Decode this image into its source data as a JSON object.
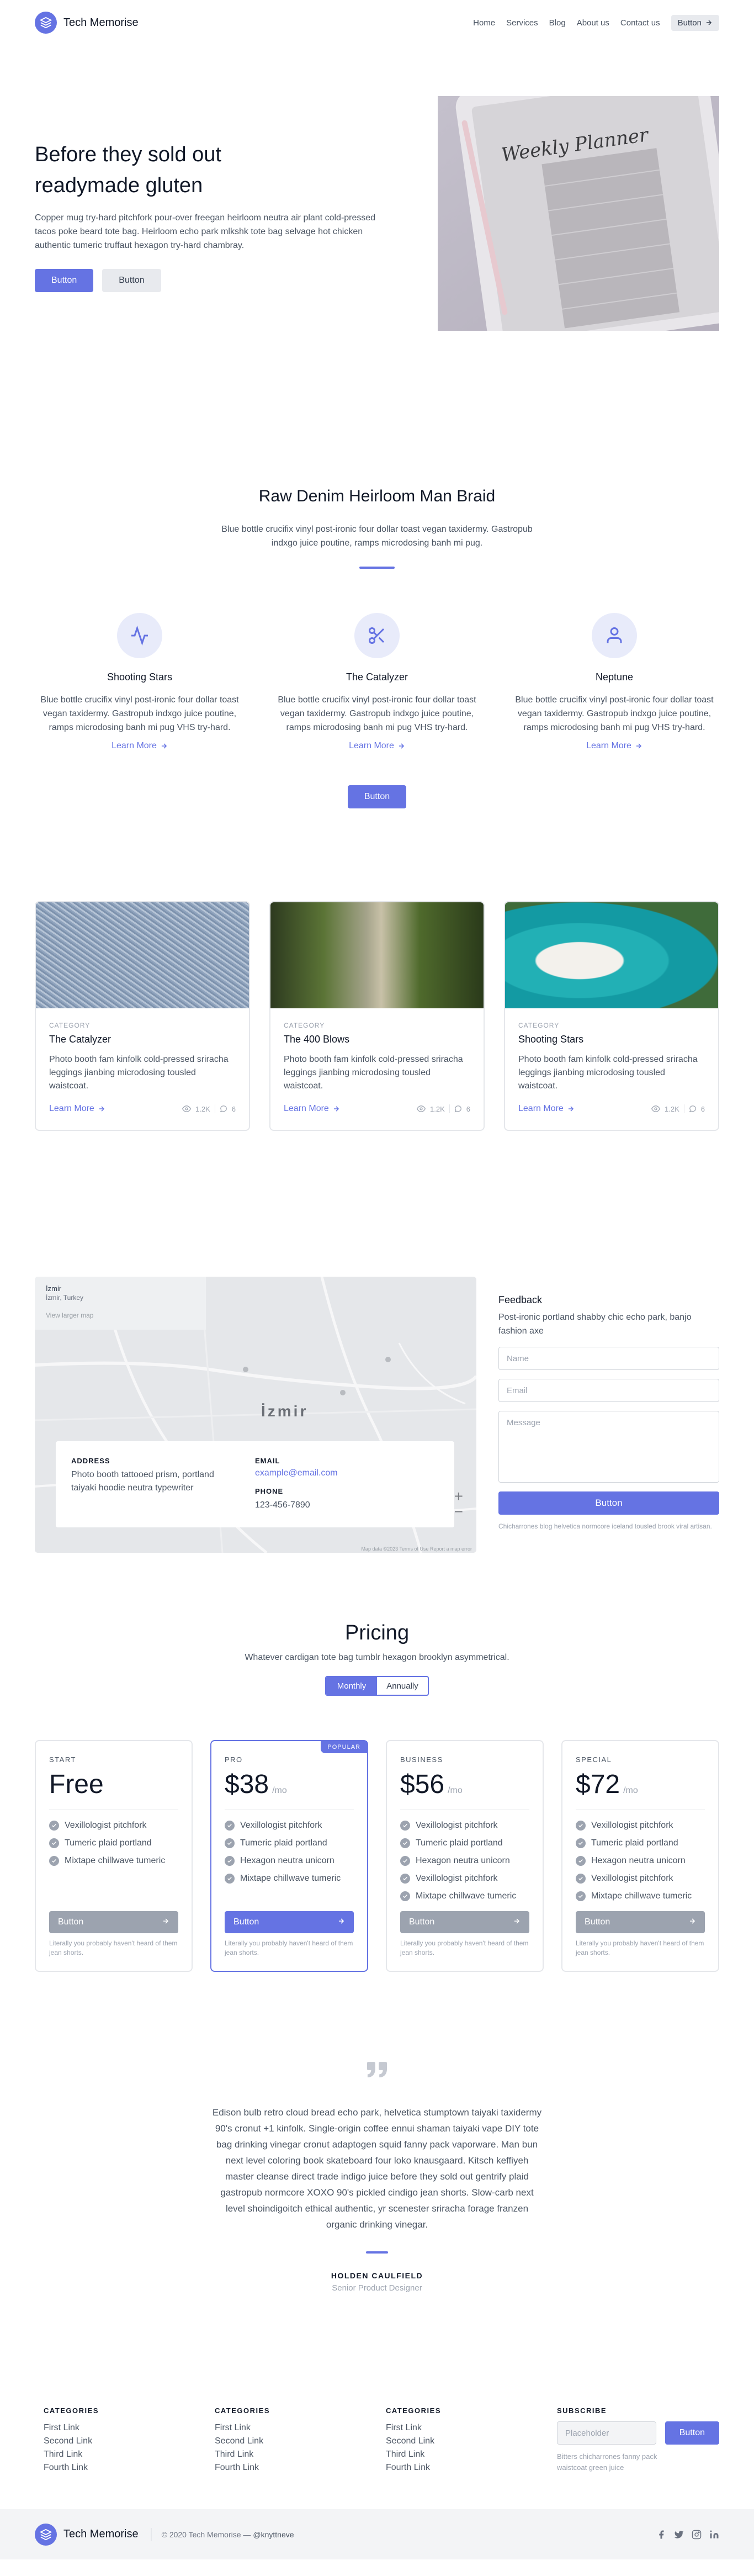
{
  "brand": {
    "name": "Tech Memorise"
  },
  "nav": {
    "items": [
      "Home",
      "Services",
      "Blog",
      "About us",
      "Contact us"
    ],
    "button": "Button"
  },
  "hero": {
    "title": "Before they sold out readymade gluten",
    "text": "Copper mug try-hard pitchfork pour-over freegan heirloom neutra air plant cold-pressed tacos poke beard tote bag. Heirloom echo park mlkshk tote bag selvage hot chicken authentic tumeric truffaut hexagon try-hard chambray.",
    "primary_button": "Button",
    "secondary_button": "Button",
    "image_text": "Weekly Planner"
  },
  "features": {
    "title": "Raw Denim Heirloom Man Braid",
    "subtitle": "Blue bottle crucifix vinyl post-ironic four dollar toast vegan taxidermy. Gastropub indxgo juice poutine, ramps microdosing banh mi pug.",
    "items": [
      {
        "icon": "pulse-icon",
        "title": "Shooting Stars",
        "text": "Blue bottle crucifix vinyl post-ironic four dollar toast vegan taxidermy. Gastropub indxgo juice poutine, ramps microdosing banh mi pug VHS try-hard.",
        "link": "Learn More"
      },
      {
        "icon": "scissors-icon",
        "title": "The Catalyzer",
        "text": "Blue bottle crucifix vinyl post-ironic four dollar toast vegan taxidermy. Gastropub indxgo juice poutine, ramps microdosing banh mi pug VHS try-hard.",
        "link": "Learn More"
      },
      {
        "icon": "user-icon",
        "title": "Neptune",
        "text": "Blue bottle crucifix vinyl post-ironic four dollar toast vegan taxidermy. Gastropub indxgo juice poutine, ramps microdosing banh mi pug VHS try-hard.",
        "link": "Learn More"
      }
    ],
    "button": "Button"
  },
  "blog": {
    "cards": [
      {
        "category": "CATEGORY",
        "title": "The Catalyzer",
        "text": "Photo booth fam kinfolk cold-pressed sriracha leggings jianbing microdosing tousled waistcoat.",
        "link": "Learn More",
        "views": "1.2K",
        "comments": "6"
      },
      {
        "category": "CATEGORY",
        "title": "The 400 Blows",
        "text": "Photo booth fam kinfolk cold-pressed sriracha leggings jianbing microdosing tousled waistcoat.",
        "link": "Learn More",
        "views": "1.2K",
        "comments": "6"
      },
      {
        "category": "CATEGORY",
        "title": "Shooting Stars",
        "text": "Photo booth fam kinfolk cold-pressed sriracha leggings jianbing microdosing tousled waistcoat.",
        "link": "Learn More",
        "views": "1.2K",
        "comments": "6"
      }
    ]
  },
  "contact": {
    "map_city": "İzmir",
    "map_box_title": "İzmir",
    "map_box_sub": "İzmir, Turkey",
    "map_box_link": "View larger map",
    "map_attribution": "Map data ©2023   Terms of Use   Report a map error",
    "address_label": "ADDRESS",
    "address": "Photo booth tattooed prism, portland taiyaki hoodie neutra typewriter",
    "email_label": "EMAIL",
    "email": "example@email.com",
    "phone_label": "PHONE",
    "phone": "123-456-7890",
    "form_title": "Feedback",
    "form_sub": "Post-ironic portland shabby chic echo park, banjo fashion axe",
    "name_placeholder": "Name",
    "email_placeholder": "Email",
    "message_placeholder": "Message",
    "button": "Button",
    "note": "Chicharrones blog helvetica normcore iceland tousled brook viral artisan."
  },
  "pricing": {
    "title": "Pricing",
    "subtitle": "Whatever cardigan tote bag tumblr hexagon brooklyn asymmetrical.",
    "toggle": {
      "monthly": "Monthly",
      "annually": "Annually"
    },
    "popular_badge": "POPULAR",
    "plans": [
      {
        "name": "START",
        "price": "Free",
        "per": "",
        "features": [
          "Vexillologist pitchfork",
          "Tumeric plaid portland",
          "Mixtape chillwave tumeric"
        ],
        "button": "Button",
        "note": "Literally you probably haven't heard of them jean shorts."
      },
      {
        "name": "PRO",
        "price": "$38",
        "per": "/mo",
        "features": [
          "Vexillologist pitchfork",
          "Tumeric plaid portland",
          "Hexagon neutra unicorn",
          "Mixtape chillwave tumeric"
        ],
        "button": "Button",
        "note": "Literally you probably haven't heard of them jean shorts."
      },
      {
        "name": "BUSINESS",
        "price": "$56",
        "per": "/mo",
        "features": [
          "Vexillologist pitchfork",
          "Tumeric plaid portland",
          "Hexagon neutra unicorn",
          "Vexillologist pitchfork",
          "Mixtape chillwave tumeric"
        ],
        "button": "Button",
        "note": "Literally you probably haven't heard of them jean shorts."
      },
      {
        "name": "SPECIAL",
        "price": "$72",
        "per": "/mo",
        "features": [
          "Vexillologist pitchfork",
          "Tumeric plaid portland",
          "Hexagon neutra unicorn",
          "Vexillologist pitchfork",
          "Mixtape chillwave tumeric"
        ],
        "button": "Button",
        "note": "Literally you probably haven't heard of them jean shorts."
      }
    ]
  },
  "testimonial": {
    "quote": "Edison bulb retro cloud bread echo park, helvetica stumptown taiyaki taxidermy 90's cronut +1 kinfolk. Single-origin coffee ennui shaman taiyaki vape DIY tote bag drinking vinegar cronut adaptogen squid fanny pack vaporware. Man bun next level coloring book skateboard four loko knausgaard. Kitsch keffiyeh master cleanse direct trade indigo juice before they sold out gentrify plaid gastropub normcore XOXO 90's pickled cindigo jean shorts. Slow-carb next level shoindigoitch ethical authentic, yr scenester sriracha forage franzen organic drinking vinegar.",
    "name": "HOLDEN CAULFIELD",
    "role": "Senior Product Designer"
  },
  "footer": {
    "columns": [
      {
        "title": "CATEGORIES",
        "links": [
          "First Link",
          "Second Link",
          "Third Link",
          "Fourth Link"
        ]
      },
      {
        "title": "CATEGORIES",
        "links": [
          "First Link",
          "Second Link",
          "Third Link",
          "Fourth Link"
        ]
      },
      {
        "title": "CATEGORIES",
        "links": [
          "First Link",
          "Second Link",
          "Third Link",
          "Fourth Link"
        ]
      }
    ],
    "subscribe": {
      "title": "SUBSCRIBE",
      "placeholder": "Placeholder",
      "button": "Button",
      "note": "Bitters chicharrones fanny pack waistcoat green juice"
    },
    "copyright": "© 2020 Tech Memorise —",
    "handle": "@knyttneve",
    "social_icons": [
      "facebook-icon",
      "twitter-icon",
      "instagram-icon",
      "linkedin-icon"
    ]
  },
  "colors": {
    "accent": "#6573e3",
    "text": "#4b5563",
    "heading": "#111827"
  }
}
